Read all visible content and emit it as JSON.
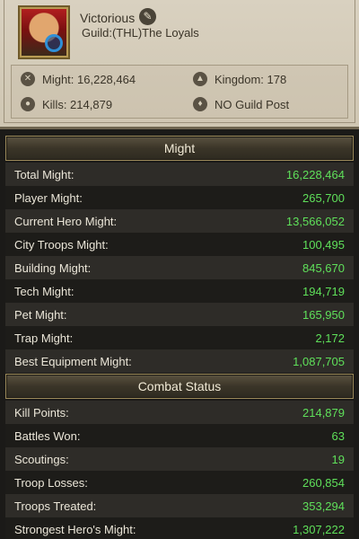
{
  "player": {
    "name": "Victorious",
    "guild": "Guild:(THL)The Loyals",
    "might_label": "Might: 16,228,464",
    "kingdom_label": "Kingdom: 178",
    "kills_label": "Kills: 214,879",
    "guild_post": "NO Guild Post"
  },
  "sections": {
    "might_title": "Might",
    "combat_title": "Combat Status"
  },
  "might_rows": [
    {
      "label": "Total Might:",
      "value": "16,228,464"
    },
    {
      "label": "Player Might:",
      "value": "265,700"
    },
    {
      "label": "Current Hero Might:",
      "value": "13,566,052"
    },
    {
      "label": "City Troops Might:",
      "value": "100,495"
    },
    {
      "label": "Building Might:",
      "value": "845,670"
    },
    {
      "label": "Tech Might:",
      "value": "194,719"
    },
    {
      "label": "Pet Might:",
      "value": "165,950"
    },
    {
      "label": "Trap Might:",
      "value": "2,172"
    },
    {
      "label": "Best Equipment Might:",
      "value": "1,087,705"
    }
  ],
  "combat_rows": [
    {
      "label": "Kill Points:",
      "value": "214,879"
    },
    {
      "label": "Battles Won:",
      "value": "63"
    },
    {
      "label": "Scoutings:",
      "value": "19"
    },
    {
      "label": "Troop Losses:",
      "value": "260,854"
    },
    {
      "label": "Troops Treated:",
      "value": "353,294"
    },
    {
      "label": "Strongest Hero's Might:",
      "value": "1,307,222"
    }
  ],
  "colors": {
    "value_green": "#5fe05a",
    "panel_beige": "#d9d1c0",
    "row_dark": "#1d1c19",
    "row_light": "#2e2c28"
  },
  "icons": {
    "edit": "pencil-icon",
    "might": "crossed-swords-icon",
    "kingdom": "helmet-icon",
    "kills": "skull-icon",
    "guild_post": "guild-crest-icon"
  }
}
